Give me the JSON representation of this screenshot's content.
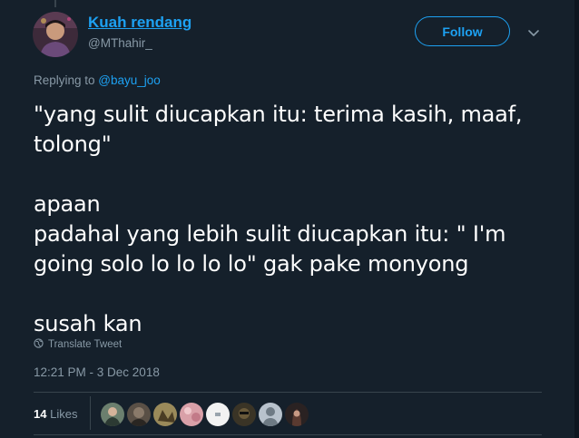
{
  "tweet": {
    "author_name": "Kuah rendang",
    "author_handle": "@MThahir_",
    "follow_label": "Follow",
    "replying_prefix": "Replying to ",
    "replying_to": "@bayu_joo",
    "text": "\"yang sulit diucapkan itu: terima kasih, maaf,\ntolong\"\n\napaan\npadahal yang lebih sulit diucapkan itu: \" I'm\ngoing solo lo lo lo lo\" gak pake monyong\n\nsusah kan",
    "translate_label": "Translate Tweet",
    "timestamp": "12:21 PM - 3 Dec 2018",
    "likes_count": "14",
    "likes_label": "Likes"
  },
  "likers": [
    {
      "name": "liker-1",
      "color": "#6b7f6e"
    },
    {
      "name": "liker-2",
      "color": "#5a5046"
    },
    {
      "name": "liker-3",
      "color": "#9a8a5a"
    },
    {
      "name": "liker-4",
      "color": "#d9a0a8"
    },
    {
      "name": "liker-5",
      "color": "#f2f2f2"
    },
    {
      "name": "liker-6",
      "color": "#3a3426"
    },
    {
      "name": "liker-7",
      "color": "#b8c2cc"
    },
    {
      "name": "liker-8",
      "color": "#2a2222"
    }
  ],
  "colors": {
    "background": "#15202b",
    "accent": "#1da1f2",
    "muted": "#8899a6"
  }
}
